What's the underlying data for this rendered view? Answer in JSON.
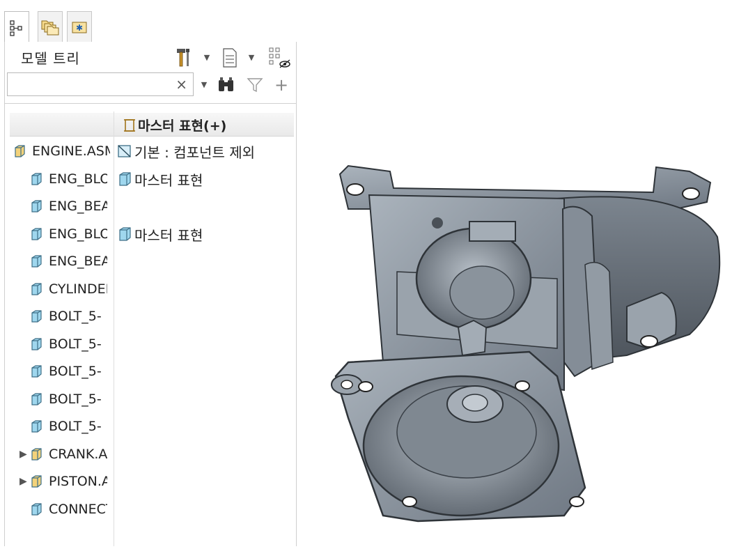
{
  "tabs": [
    {
      "name": "model-tree-tab",
      "icon": "tree-icon",
      "active": true
    },
    {
      "name": "folder-browser-tab",
      "icon": "folders-icon",
      "active": false
    },
    {
      "name": "favorites-tab",
      "icon": "star-folder-icon",
      "active": false
    }
  ],
  "panel": {
    "title": "모델 트리",
    "search_value": "",
    "search_clear": "×"
  },
  "tree": {
    "col2_header": "마스터 표현(+)",
    "items": [
      {
        "label": "ENGINE.ASM",
        "type": "assembly",
        "level": 0,
        "expander": "",
        "col2": "기본 : 컴포넌트 제외",
        "col2_icon": "excluded-icon"
      },
      {
        "label": "ENG_BLOCK",
        "type": "part",
        "level": 1,
        "expander": "",
        "col2": "마스터 표현",
        "col2_icon": "part-icon"
      },
      {
        "label": "ENG_BEARING",
        "type": "part",
        "level": 1,
        "expander": "",
        "col2": "",
        "col2_icon": ""
      },
      {
        "label": "ENG_BLOCK",
        "type": "part",
        "level": 1,
        "expander": "",
        "col2": "마스터 표현",
        "col2_icon": "part-icon"
      },
      {
        "label": "ENG_BEARING",
        "type": "part",
        "level": 1,
        "expander": "",
        "col2": "",
        "col2_icon": ""
      },
      {
        "label": "CYLINDER",
        "type": "part",
        "level": 1,
        "expander": "",
        "col2": "",
        "col2_icon": ""
      },
      {
        "label": "BOLT_5-",
        "type": "part",
        "level": 1,
        "expander": "",
        "col2": "",
        "col2_icon": ""
      },
      {
        "label": "BOLT_5-",
        "type": "part",
        "level": 1,
        "expander": "",
        "col2": "",
        "col2_icon": ""
      },
      {
        "label": "BOLT_5-",
        "type": "part",
        "level": 1,
        "expander": "",
        "col2": "",
        "col2_icon": ""
      },
      {
        "label": "BOLT_5-",
        "type": "part",
        "level": 1,
        "expander": "",
        "col2": "",
        "col2_icon": ""
      },
      {
        "label": "BOLT_5-",
        "type": "part",
        "level": 1,
        "expander": "",
        "col2": "",
        "col2_icon": ""
      },
      {
        "label": "CRANK.ASM",
        "type": "assembly",
        "level": 1,
        "expander": "▶",
        "col2": "",
        "col2_icon": ""
      },
      {
        "label": "PISTON.ASM",
        "type": "assembly",
        "level": 1,
        "expander": "▶",
        "col2": "",
        "col2_icon": ""
      },
      {
        "label": "CONNECTING_ROD",
        "type": "part",
        "level": 1,
        "expander": "",
        "col2": "",
        "col2_icon": ""
      }
    ]
  },
  "colors": {
    "part_fill": "#9fd7ee",
    "assembly_fill": "#f3d27a",
    "model_body": "#8d97a1"
  }
}
